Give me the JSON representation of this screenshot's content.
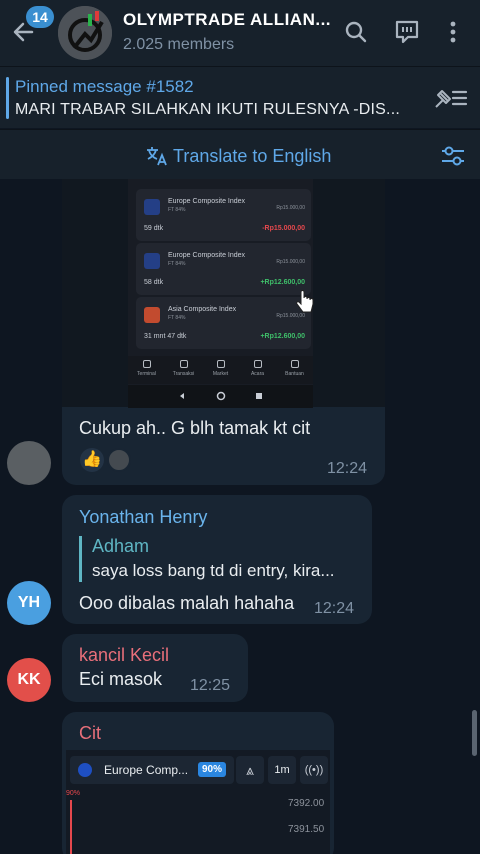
{
  "header": {
    "back_badge": "14",
    "title": "OLYMPTRADE ALLIAN...",
    "members": "2.025 members",
    "icons": [
      "back-arrow-icon",
      "search-icon",
      "chat-bubble-icon",
      "more-vertical-icon"
    ]
  },
  "pinned": {
    "title": "Pinned message #1582",
    "text": "MARI TRABAR  SILAHKAN IKUTI RULESNYA  -DIS..."
  },
  "translate": {
    "label": "Translate to English"
  },
  "screenshot": {
    "cards": [
      {
        "name": "Europe Composite Index",
        "sub": "FT  84%",
        "rate": "Rp15.000,00",
        "time": "59 dtk",
        "amount": "-Rp15.000,00",
        "amount_color": "#e5484d"
      },
      {
        "name": "Europe Composite Index",
        "sub": "FT  84%",
        "rate": "Rp15.000,00",
        "time": "58 dtk",
        "amount": "+Rp12.600,00",
        "amount_color": "#3fbf6a"
      },
      {
        "name": "Asia Composite Index",
        "sub": "FT  84%",
        "rate": "Rp15.000,00",
        "time": "31 mnt 47 dtk",
        "amount": "+Rp12.600,00",
        "amount_color": "#3fbf6a"
      }
    ],
    "nav": [
      "Terminal",
      "Transaksi",
      "Market",
      "Acara",
      "Bantuan"
    ]
  },
  "messages": {
    "m1": {
      "text": "Cukup ah.. G blh tamak kt cit",
      "time": "12:24"
    },
    "m2": {
      "sender": "Yonathan Henry",
      "avatar": "YH",
      "quote_name": "Adham",
      "quote_text": "saya loss bang td di entry, kira...",
      "text": "Ooo dibalas malah hahaha",
      "time": "12:24"
    },
    "m3": {
      "sender": "kancil Kecil",
      "avatar": "KK",
      "text": "Eci masok",
      "time": "12:25"
    },
    "m4": {
      "sender": "Cit",
      "ticker": "Europe Comp...",
      "pct": "90%",
      "interval": "1m",
      "price_top": "7392.00",
      "price_2": "7391.50",
      "pct_marker": "90%"
    }
  },
  "colors": {
    "accent": "#5fa8e8",
    "sender_yh": "#6ab4ec",
    "sender_kk": "#e86f7a",
    "avatar_yh": "#4a9fe0",
    "avatar_kk": "#e24f4a"
  }
}
